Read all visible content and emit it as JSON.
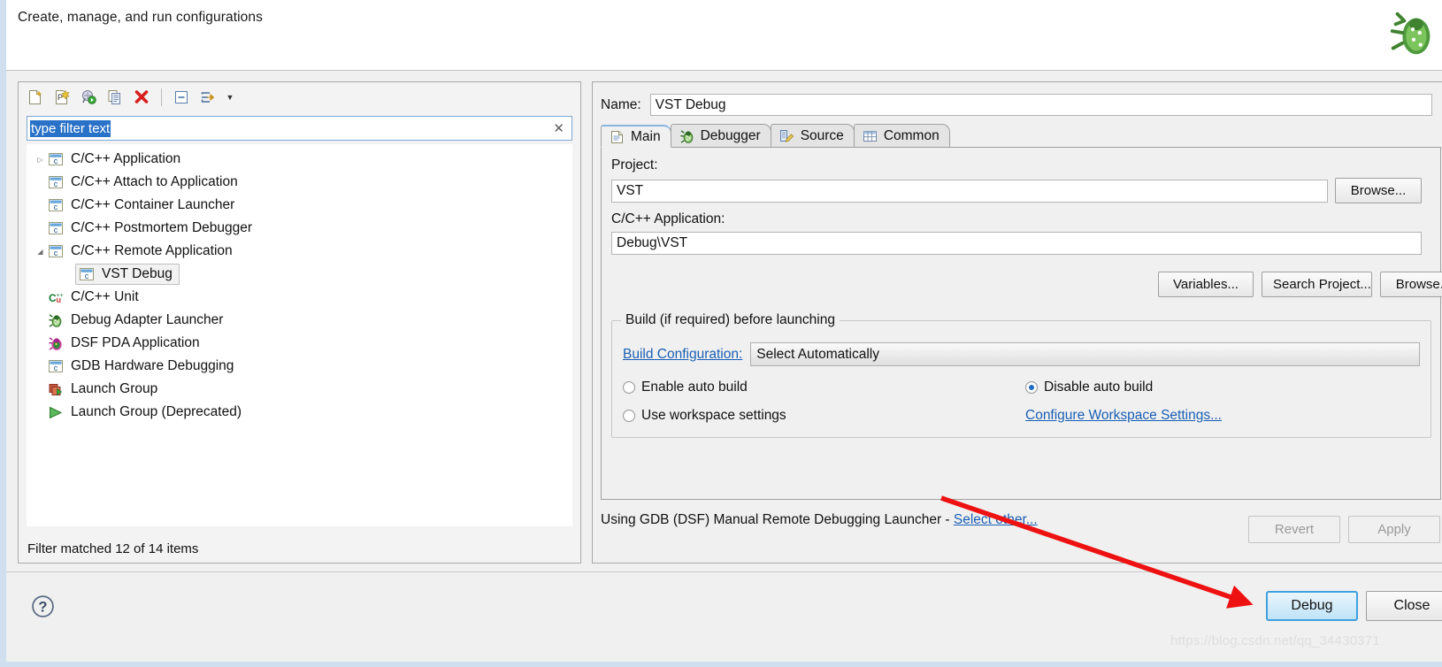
{
  "banner": {
    "title": "Create, manage, and run configurations",
    "icon": "bug-icon"
  },
  "toolbar": {
    "buttons": [
      {
        "name": "new-configuration-icon",
        "label": "New launch configuration"
      },
      {
        "name": "new-prototype-icon",
        "label": "New prototype"
      },
      {
        "name": "export-icon",
        "label": "Export"
      },
      {
        "name": "duplicate-icon",
        "label": "Duplicate"
      },
      {
        "name": "delete-icon",
        "label": "Delete"
      },
      {
        "name": "collapse-all-icon",
        "label": "Collapse All"
      },
      {
        "name": "filter-icon",
        "label": "Filter launch configurations"
      }
    ],
    "menu_arrow": "▼"
  },
  "filter": {
    "value": "type filter text",
    "placeholder": "type filter text",
    "clear": "✕"
  },
  "tree": {
    "items": [
      {
        "label": "C/C++ Application",
        "icon": "c-file-icon",
        "twisty": "▷",
        "indent": 0,
        "selected": false
      },
      {
        "label": "C/C++ Attach to Application",
        "icon": "c-file-icon",
        "twisty": "",
        "indent": 0,
        "selected": false
      },
      {
        "label": "C/C++ Container Launcher",
        "icon": "c-file-icon",
        "twisty": "",
        "indent": 0,
        "selected": false
      },
      {
        "label": "C/C++ Postmortem Debugger",
        "icon": "c-file-icon",
        "twisty": "",
        "indent": 0,
        "selected": false
      },
      {
        "label": "C/C++ Remote Application",
        "icon": "c-file-icon",
        "twisty": "◢",
        "indent": 0,
        "selected": false
      },
      {
        "label": "VST Debug",
        "icon": "c-file-icon",
        "twisty": "",
        "indent": 1,
        "selected": true
      },
      {
        "label": "C/C++ Unit",
        "icon": "cunit-icon",
        "twisty": "",
        "indent": 0,
        "selected": false
      },
      {
        "label": "Debug Adapter Launcher",
        "icon": "bug-icon",
        "twisty": "",
        "indent": 0,
        "selected": false
      },
      {
        "label": "DSF PDA Application",
        "icon": "pda-bug-icon",
        "twisty": "",
        "indent": 0,
        "selected": false
      },
      {
        "label": "GDB Hardware Debugging",
        "icon": "c-file-icon",
        "twisty": "",
        "indent": 0,
        "selected": false
      },
      {
        "label": "Launch Group",
        "icon": "launch-group-icon",
        "twisty": "",
        "indent": 0,
        "selected": false
      },
      {
        "label": "Launch Group (Deprecated)",
        "icon": "launch-group-deprecated-icon",
        "twisty": "",
        "indent": 0,
        "selected": false
      }
    ],
    "status": "Filter matched 12 of 14 items"
  },
  "config": {
    "name_label": "Name:",
    "name_value": "VST Debug",
    "tabs": [
      {
        "label": "Main",
        "icon": "document-icon",
        "active": true
      },
      {
        "label": "Debugger",
        "icon": "bug-icon",
        "active": false
      },
      {
        "label": "Source",
        "icon": "source-edit-icon",
        "active": false
      },
      {
        "label": "Common",
        "icon": "table-icon",
        "active": false
      }
    ],
    "project_label": "Project:",
    "project_value": "VST",
    "project_browse": "Browse...",
    "application_label": "C/C++ Application:",
    "application_value": "Debug\\VST",
    "variables_button": "Variables...",
    "search_project_button": "Search Project...",
    "app_browse_button": "Browse...",
    "build_group_title": "Build (if required) before launching",
    "build_configuration_link": "Build Configuration:",
    "build_configuration_value": "Select Automatically",
    "radios": [
      {
        "label": "Enable auto build",
        "checked": false
      },
      {
        "label": "Disable auto build",
        "checked": true
      },
      {
        "label": "Use workspace settings",
        "checked": false
      }
    ],
    "configure_workspace_link": "Configure Workspace Settings...",
    "launcher_note_prefix": "Using GDB (DSF) Manual Remote Debugging Launcher - ",
    "launcher_note_link": "Select other...",
    "revert_button": "Revert",
    "apply_button": "Apply"
  },
  "bottom": {
    "help_icon": "help-icon",
    "debug_button": "Debug",
    "close_button": "Close"
  },
  "annotation": {
    "arrow_color": "#ee1111",
    "watermark": "https://blog.csdn.net/qq_34430371"
  }
}
